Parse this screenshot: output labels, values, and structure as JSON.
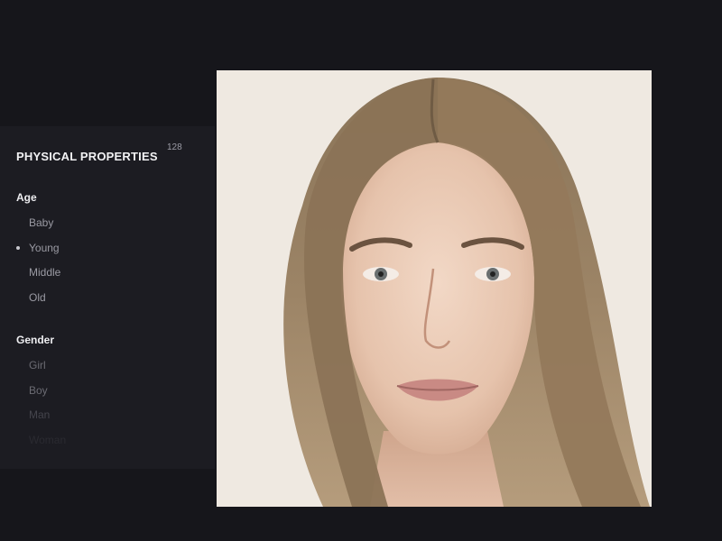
{
  "panel": {
    "title": "PHYSICAL PROPERTIES",
    "count": "128"
  },
  "groups": {
    "age": {
      "title": "Age",
      "options": [
        "Baby",
        "Young",
        "Middle",
        "Old"
      ],
      "selected": "Young"
    },
    "gender": {
      "title": "Gender",
      "options": [
        "Girl",
        "Boy",
        "Man",
        "Woman"
      ]
    }
  },
  "colors": {
    "background": "#16161b",
    "sidebar": "#1c1c22",
    "preview_background": "#efe9e1"
  }
}
